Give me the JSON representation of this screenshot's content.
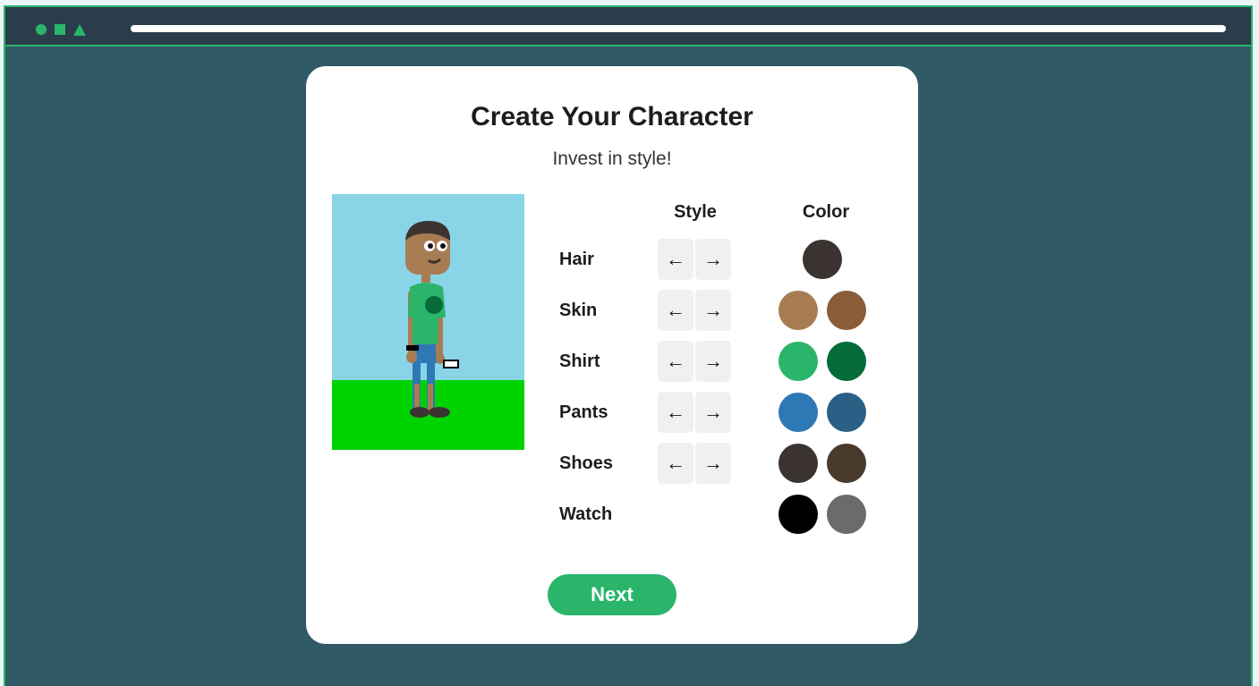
{
  "card": {
    "title": "Create Your Character",
    "subtitle": "Invest in style!"
  },
  "columns": {
    "style": "Style",
    "color": "Color"
  },
  "arrows": {
    "left": "←",
    "right": "→"
  },
  "rows": [
    {
      "label": "Hair",
      "has_style": true,
      "colors": [
        "#3b3331"
      ]
    },
    {
      "label": "Skin",
      "has_style": true,
      "colors": [
        "#a87c52",
        "#8b5c38"
      ]
    },
    {
      "label": "Shirt",
      "has_style": true,
      "colors": [
        "#2ab56b",
        "#056b38"
      ]
    },
    {
      "label": "Pants",
      "has_style": true,
      "colors": [
        "#2d78b5",
        "#2a5f86"
      ]
    },
    {
      "label": "Shoes",
      "has_style": true,
      "colors": [
        "#3b3331",
        "#4a3a2c"
      ]
    },
    {
      "label": "Watch",
      "has_style": false,
      "colors": [
        "#000000",
        "#6b6b6b"
      ]
    }
  ],
  "next_button": {
    "label": "Next"
  },
  "colors": {
    "accent": "#2ab56b",
    "window_bg": "#305a66",
    "titlebar_bg": "#2a3d4a",
    "sky": "#8ad4e8",
    "grass": "#00d400"
  },
  "titlebar": {
    "icons": [
      "circle-icon",
      "square-icon",
      "triangle-icon"
    ]
  }
}
